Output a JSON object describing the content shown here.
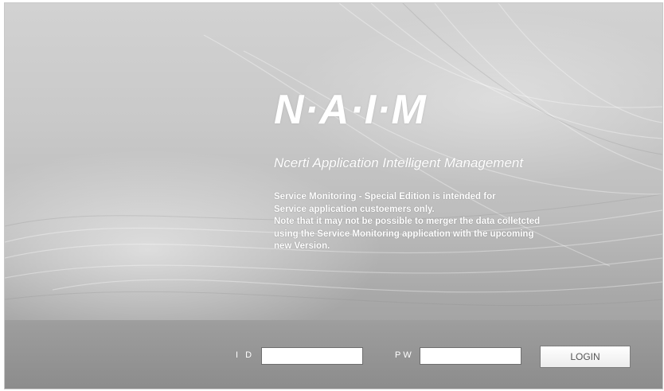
{
  "branding": {
    "logo": "N·A·I·M",
    "subtitle": "Ncerti Application Intelligent Management"
  },
  "notice": {
    "lines": [
      "Service Monitoring - Special Edition is intended for",
      "Service application custoemers only.",
      "Note that it may not be possible to merger the data colletcted",
      "using the Service Monitoring application with the upcoming",
      "new Version."
    ]
  },
  "login": {
    "id_label": "I D",
    "id_value": "",
    "pw_label": "PW",
    "pw_value": "",
    "button_label": "LOGIN"
  },
  "colors": {
    "background": "#c4c4c4",
    "bottom_bar": "#939393",
    "text": "#ffffff"
  }
}
